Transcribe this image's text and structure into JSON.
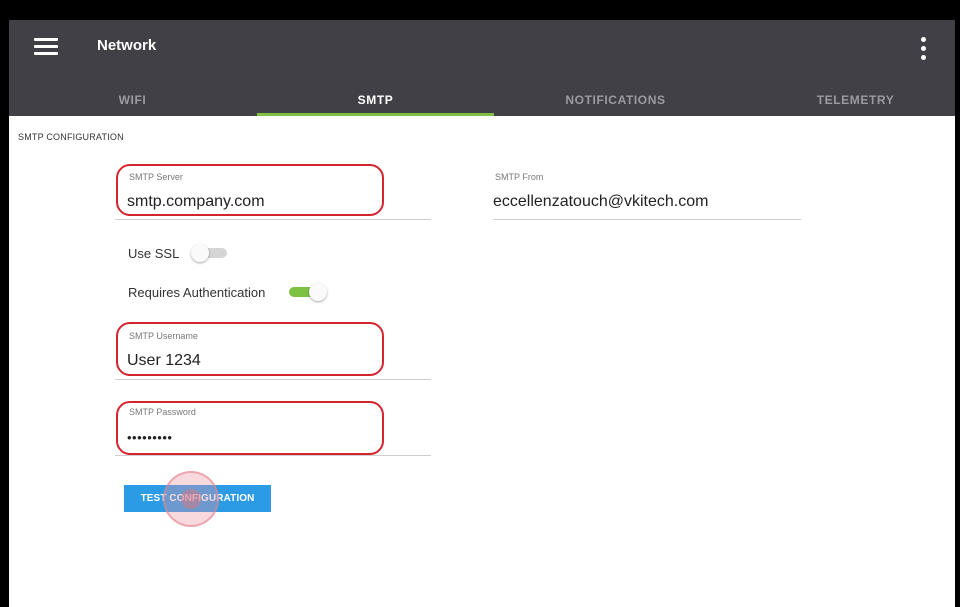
{
  "appbar": {
    "title": "Network",
    "menu_icon": "hamburger-menu-icon",
    "more_icon": "more-vertical-icon",
    "bg_color": "#414047"
  },
  "tabs": [
    {
      "label": "WIFI",
      "active": false
    },
    {
      "label": "SMTP",
      "active": true
    },
    {
      "label": "NOTIFICATIONS",
      "active": false
    },
    {
      "label": "TELEMETRY",
      "active": false
    }
  ],
  "accent_color": "#7dc242",
  "highlight_color": "#d4252f",
  "section": {
    "title": "SMTP CONFIGURATION"
  },
  "fields": {
    "smtp_server": {
      "label": "SMTP Server",
      "value": "smtp.company.com"
    },
    "smtp_from": {
      "label": "SMTP From",
      "value": "eccellenzatouch@vkitech.com"
    },
    "smtp_username": {
      "label": "SMTP Username",
      "value": "User 1234"
    },
    "smtp_password": {
      "label": "SMTP Password",
      "value": "•••••••••"
    }
  },
  "toggles": {
    "use_ssl": {
      "label": "Use SSL",
      "on": false
    },
    "requires_auth": {
      "label": "Requires Authentication",
      "on": true
    }
  },
  "test_button": {
    "label": "TEST CONFIGURATION",
    "color": "#2c9be6"
  }
}
